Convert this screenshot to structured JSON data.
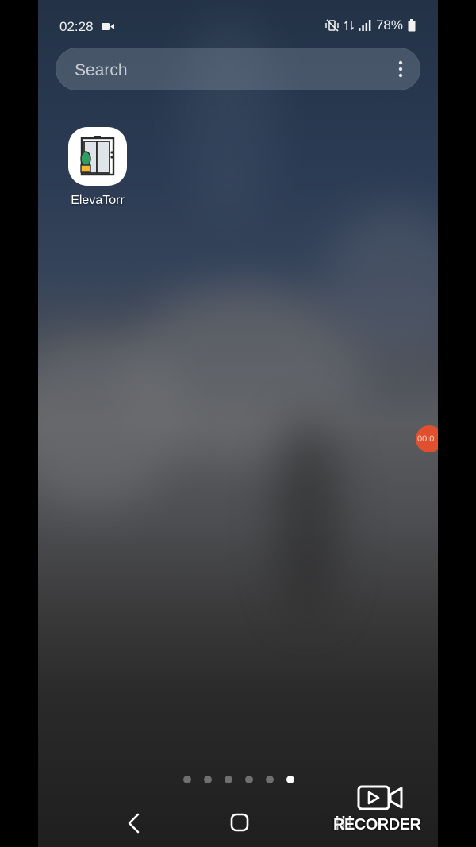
{
  "status_bar": {
    "time": "02:28",
    "battery_percent": "78%",
    "icons": [
      "video-record-icon",
      "mute-vibrate-icon",
      "data-arrows-icon",
      "signal-icon",
      "battery-icon"
    ]
  },
  "search": {
    "placeholder": "Search",
    "menu_icon": "more-vert-icon"
  },
  "apps": [
    {
      "label": "ElevaTorr",
      "icon": "elevator-icon"
    }
  ],
  "floating_bubble": {
    "text": "00:0"
  },
  "page_indicator": {
    "pages": 6,
    "active_index": 5
  },
  "nav_bar": {
    "back_icon": "chevron-left-icon",
    "home_icon": "home-square-icon",
    "recent_icon": "recent-apps-icon"
  },
  "watermark": {
    "text": "RECORDER"
  },
  "colors": {
    "bubble": "#e0502e",
    "text": "#ffffff"
  }
}
